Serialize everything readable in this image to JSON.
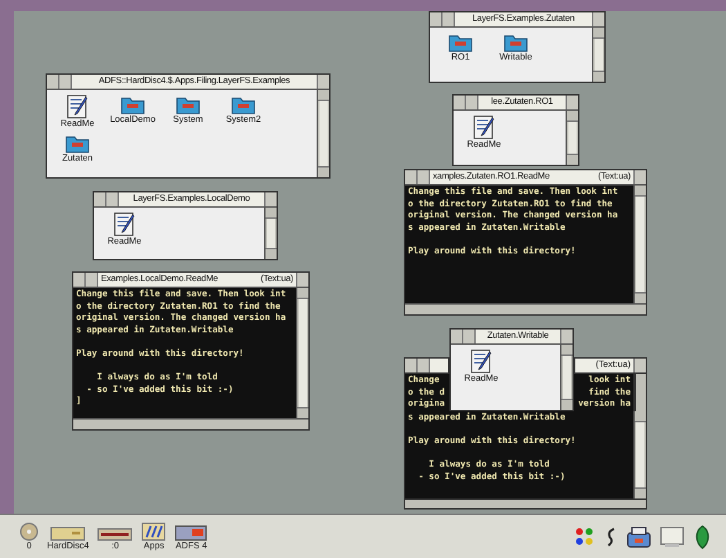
{
  "windows": [
    {
      "kind": "filer",
      "title": "ADFS::HardDisc4.$.Apps.Filing.LayerFS.Examples",
      "items": [
        {
          "kind": "file",
          "label": "ReadMe"
        },
        {
          "kind": "folder",
          "label": "LocalDemo"
        },
        {
          "kind": "folder",
          "label": "System"
        },
        {
          "kind": "folder",
          "label": "System2"
        },
        {
          "kind": "folder",
          "label": "Zutaten"
        }
      ]
    },
    {
      "kind": "filer",
      "title": "LayerFS.Examples.LocalDemo",
      "items": [
        {
          "kind": "file",
          "label": "ReadMe"
        }
      ]
    },
    {
      "kind": "text",
      "title": "Examples.LocalDemo.ReadMe",
      "tag": "(Text:ua)",
      "lines": [
        {
          "kind": "text",
          "parts": [
            "Change this file and save. Then look int"
          ]
        },
        {
          "kind": "text",
          "parts": [
            "o the directory Zutaten.RO1 to find the"
          ]
        },
        {
          "kind": "text",
          "parts": [
            "original version. The changed version ha"
          ]
        },
        {
          "kind": "text",
          "parts": [
            "s appeared in Zutaten.Writable"
          ]
        },
        {
          "kind": "blank"
        },
        {
          "kind": "text",
          "parts": [
            "Play around with this directory!"
          ]
        },
        {
          "kind": "blank"
        },
        {
          "kind": "text",
          "parts": [
            "    I always do as I'm told"
          ]
        },
        {
          "kind": "text",
          "parts": [
            "  - so I've added this bit :-)"
          ]
        },
        {
          "kind": "text",
          "parts": [
            "]"
          ]
        }
      ]
    },
    {
      "kind": "filer",
      "title": "LayerFS.Examples.Zutaten",
      "items": [
        {
          "kind": "folder",
          "label": "RO1"
        },
        {
          "kind": "folder",
          "label": "Writable"
        }
      ]
    },
    {
      "kind": "filer",
      "title": "lee.Zutaten.RO1",
      "items": [
        {
          "kind": "file",
          "label": "ReadMe"
        }
      ]
    },
    {
      "kind": "text",
      "title": "xamples.Zutaten.RO1.ReadMe",
      "tag": "(Text:ua)",
      "lines": [
        {
          "kind": "text",
          "parts": [
            "Change this file and save. Then look int"
          ]
        },
        {
          "kind": "text",
          "parts": [
            "o the directory Zutaten.RO1 to find the"
          ]
        },
        {
          "kind": "text",
          "parts": [
            "original version. The changed version ha"
          ]
        },
        {
          "kind": "text",
          "parts": [
            "s appeared in Zutaten.Writable"
          ]
        },
        {
          "kind": "blank"
        },
        {
          "kind": "text",
          "parts": [
            "Play around with this directory!"
          ]
        }
      ]
    },
    {
      "kind": "text",
      "tag": "(Text:ua)",
      "lines": [
        {
          "kind": "text",
          "parts": [
            "Change",
            "look int"
          ]
        },
        {
          "kind": "text",
          "parts": [
            "o the d",
            "find the"
          ]
        },
        {
          "kind": "text",
          "parts": [
            "origina",
            "version ha"
          ]
        },
        {
          "kind": "text",
          "parts": [
            "s appeared in Zutaten.Writable"
          ]
        },
        {
          "kind": "blank"
        },
        {
          "kind": "text",
          "parts": [
            "Play around with this directory!"
          ]
        },
        {
          "kind": "blank"
        },
        {
          "kind": "text",
          "parts": [
            "    I always do as I'm told"
          ]
        },
        {
          "kind": "text",
          "parts": [
            "  - so I've added this bit :-)"
          ]
        }
      ]
    },
    {
      "kind": "filer",
      "title": "Zutaten.Writable",
      "items": [
        {
          "kind": "file",
          "label": "ReadMe"
        }
      ]
    }
  ],
  "icon_bar": {
    "left": [
      {
        "kind": "cd",
        "label": "0"
      },
      {
        "kind": "disc",
        "label": "HardDisc4"
      },
      {
        "kind": "floppy",
        "label": ":0"
      },
      {
        "kind": "apps",
        "label": "Apps"
      },
      {
        "kind": "adfs",
        "label": "ADFS 4"
      }
    ],
    "right": [
      {
        "kind": "palette"
      },
      {
        "kind": "task"
      },
      {
        "kind": "printer"
      },
      {
        "kind": "display"
      },
      {
        "kind": "acorn"
      }
    ]
  }
}
